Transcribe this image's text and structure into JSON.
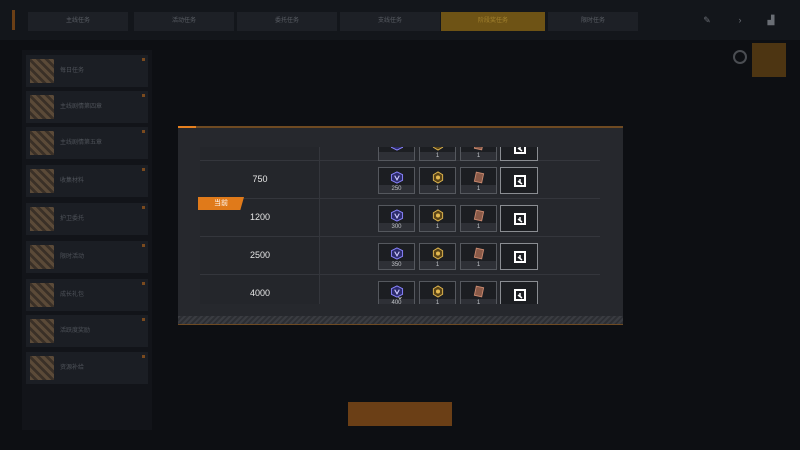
{
  "topbar": {
    "tabs": [
      "主线任务",
      "活动任务",
      "委托任务",
      "支线任务",
      "阶段奖任务",
      "限时任务"
    ],
    "active_tab_index": 4
  },
  "sidebar": {
    "items": [
      "每日任务",
      "主线剧情第四章",
      "主线剧情第五章",
      "收集材料",
      "护卫委托",
      "限时活动",
      "成长礼包",
      "活跃度奖励",
      "资源补给"
    ]
  },
  "modal": {
    "current_badge": "当前",
    "rows": [
      {
        "threshold": "",
        "rewards": [
          "",
          "1",
          "1"
        ]
      },
      {
        "threshold": "750",
        "rewards": [
          "250",
          "1",
          "1"
        ]
      },
      {
        "threshold": "1200",
        "rewards": [
          "300",
          "1",
          "1"
        ]
      },
      {
        "threshold": "2500",
        "rewards": [
          "350",
          "1",
          "1"
        ]
      },
      {
        "threshold": "4000",
        "rewards": [
          "400",
          "1",
          "1"
        ]
      }
    ],
    "current_row_index": 2,
    "reward_icons": [
      "crystal-icon",
      "medal-icon",
      "card-icon"
    ],
    "shop_icon": "shop-icon"
  },
  "colors": {
    "accent": "#e07a1a",
    "crystal": "#6a63d8",
    "medal": "#d9b04a",
    "card": "#b5775e"
  }
}
